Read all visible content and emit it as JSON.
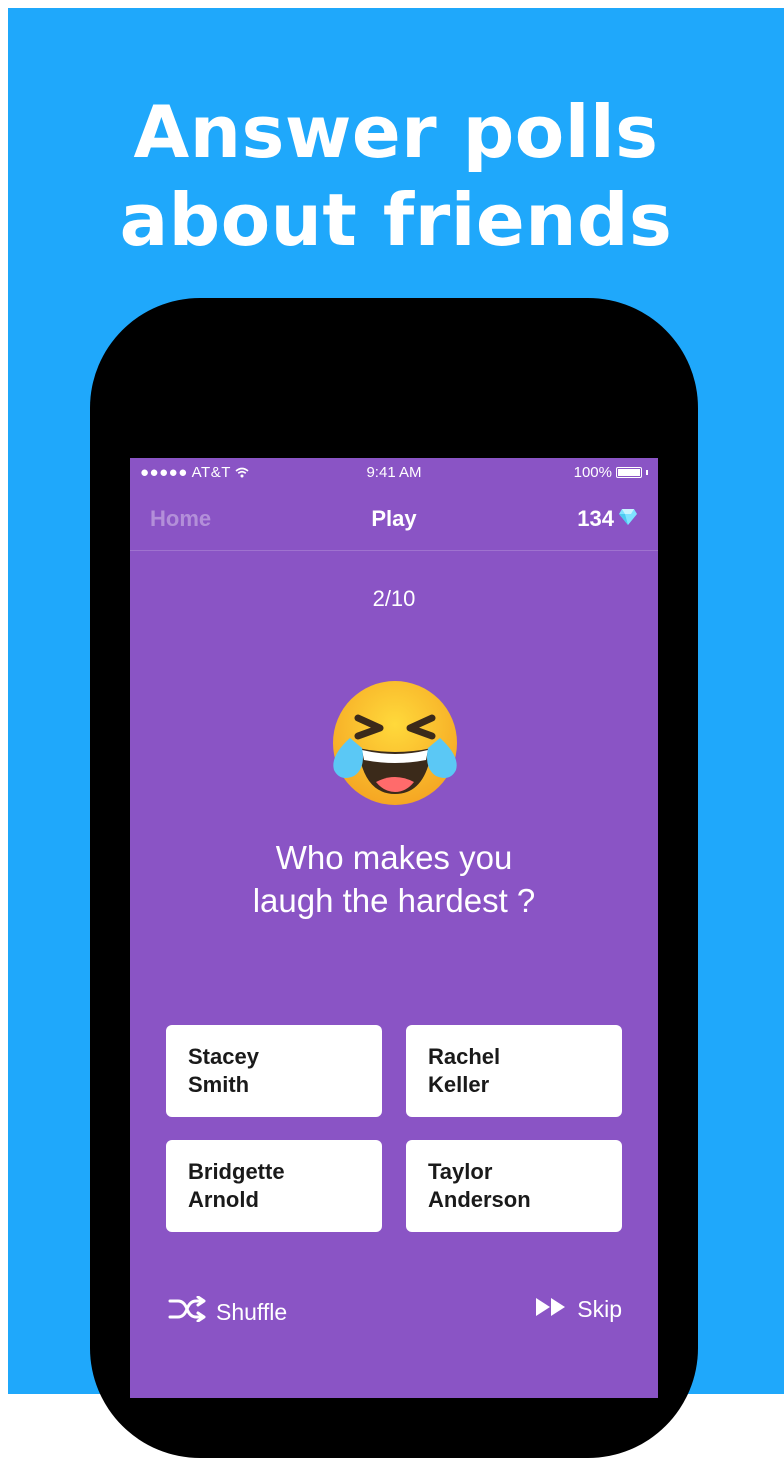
{
  "headline": {
    "line1": "Answer polls",
    "line2": "about friends"
  },
  "statusbar": {
    "carrier": "●●●●● AT&T",
    "time": "9:41 AM",
    "battery": "100%"
  },
  "navbar": {
    "back_label": "Home",
    "title": "Play",
    "gems": "134",
    "gem_icon": "diamond-icon"
  },
  "question": {
    "progress": "2/10",
    "emoji_icon": "tears-of-joy-emoji",
    "line1": "Who makes you",
    "line2": "laugh the hardest ?"
  },
  "options": [
    {
      "first": "Stacey",
      "last": "Smith"
    },
    {
      "first": "Rachel",
      "last": "Keller"
    },
    {
      "first": "Bridgette",
      "last": "Arnold"
    },
    {
      "first": "Taylor",
      "last": "Anderson"
    }
  ],
  "actions": {
    "shuffle_label": "Shuffle",
    "skip_label": "Skip"
  },
  "colors": {
    "background": "#1fa8fb",
    "screen": "#8a54c5",
    "phone": "#000000",
    "card": "#ffffff"
  }
}
